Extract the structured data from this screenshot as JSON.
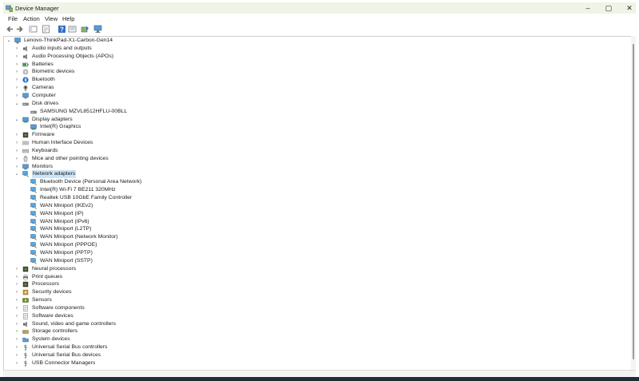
{
  "window": {
    "title": "Device Manager"
  },
  "menu": {
    "file": "File",
    "action": "Action",
    "view": "View",
    "help": "Help"
  },
  "tree": {
    "root": "Lenovo-ThinkPad-X1-Carbon-Gen14",
    "rows": [
      {
        "label": "Audio inputs and outputs",
        "level": 1,
        "state": "collapsed",
        "icon": "speaker-icon"
      },
      {
        "label": "Audio Processing Objects (APOs)",
        "level": 1,
        "state": "collapsed",
        "icon": "speaker-icon"
      },
      {
        "label": "Batteries",
        "level": 1,
        "state": "collapsed",
        "icon": "battery-icon"
      },
      {
        "label": "Biometric devices",
        "level": 1,
        "state": "collapsed",
        "icon": "fingerprint-icon"
      },
      {
        "label": "Bluetooth",
        "level": 1,
        "state": "collapsed",
        "icon": "bluetooth-icon"
      },
      {
        "label": "Cameras",
        "level": 1,
        "state": "collapsed",
        "icon": "camera-icon"
      },
      {
        "label": "Computer",
        "level": 1,
        "state": "collapsed",
        "icon": "monitor-icon"
      },
      {
        "label": "Disk drives",
        "level": 1,
        "state": "expanded",
        "icon": "disk-icon"
      },
      {
        "label": "SAMSUNG MZVL8512HFLU-00BLL",
        "level": 2,
        "state": "leaf",
        "icon": "disk-icon"
      },
      {
        "label": "Display adapters",
        "level": 1,
        "state": "expanded",
        "icon": "display-adapter-icon"
      },
      {
        "label": "Intel(R) Graphics",
        "level": 2,
        "state": "leaf",
        "icon": "display-adapter-icon"
      },
      {
        "label": "Firmware",
        "level": 1,
        "state": "collapsed",
        "icon": "chip-icon"
      },
      {
        "label": "Human Interface Devices",
        "level": 1,
        "state": "collapsed",
        "icon": "hid-icon"
      },
      {
        "label": "Keyboards",
        "level": 1,
        "state": "collapsed",
        "icon": "keyboard-icon"
      },
      {
        "label": "Mice and other pointing devices",
        "level": 1,
        "state": "collapsed",
        "icon": "mouse-icon"
      },
      {
        "label": "Monitors",
        "level": 1,
        "state": "collapsed",
        "icon": "monitor-icon"
      },
      {
        "label": "Network adapters",
        "level": 1,
        "state": "expanded",
        "icon": "network-icon",
        "selected": true
      },
      {
        "label": "Bluetooth Device (Personal Area Network)",
        "level": 2,
        "state": "leaf",
        "icon": "network-icon"
      },
      {
        "label": "Intel(R) Wi-Fi 7 BE211 320MHz",
        "level": 2,
        "state": "leaf",
        "icon": "network-icon"
      },
      {
        "label": "Realtek USB 10GbE Family Controller",
        "level": 2,
        "state": "leaf",
        "icon": "network-icon"
      },
      {
        "label": "WAN Miniport (IKEv2)",
        "level": 2,
        "state": "leaf",
        "icon": "network-icon"
      },
      {
        "label": "WAN Miniport (IP)",
        "level": 2,
        "state": "leaf",
        "icon": "network-icon"
      },
      {
        "label": "WAN Miniport (IPv6)",
        "level": 2,
        "state": "leaf",
        "icon": "network-icon"
      },
      {
        "label": "WAN Miniport (L2TP)",
        "level": 2,
        "state": "leaf",
        "icon": "network-icon"
      },
      {
        "label": "WAN Miniport (Network Monitor)",
        "level": 2,
        "state": "leaf",
        "icon": "network-icon"
      },
      {
        "label": "WAN Miniport (PPPOE)",
        "level": 2,
        "state": "leaf",
        "icon": "network-icon"
      },
      {
        "label": "WAN Miniport (PPTP)",
        "level": 2,
        "state": "leaf",
        "icon": "network-icon"
      },
      {
        "label": "WAN Miniport (SSTP)",
        "level": 2,
        "state": "leaf",
        "icon": "network-icon"
      },
      {
        "label": "Neural processors",
        "level": 1,
        "state": "collapsed",
        "icon": "chip-icon"
      },
      {
        "label": "Print queues",
        "level": 1,
        "state": "collapsed",
        "icon": "printer-icon"
      },
      {
        "label": "Processors",
        "level": 1,
        "state": "collapsed",
        "icon": "chip-icon"
      },
      {
        "label": "Security devices",
        "level": 1,
        "state": "collapsed",
        "icon": "security-icon"
      },
      {
        "label": "Sensors",
        "level": 1,
        "state": "collapsed",
        "icon": "sensor-icon"
      },
      {
        "label": "Software components",
        "level": 1,
        "state": "collapsed",
        "icon": "software-icon"
      },
      {
        "label": "Software devices",
        "level": 1,
        "state": "collapsed",
        "icon": "software-icon"
      },
      {
        "label": "Sound, video and game controllers",
        "level": 1,
        "state": "collapsed",
        "icon": "speaker-icon"
      },
      {
        "label": "Storage controllers",
        "level": 1,
        "state": "collapsed",
        "icon": "storage-icon"
      },
      {
        "label": "System devices",
        "level": 1,
        "state": "collapsed",
        "icon": "folder-icon"
      },
      {
        "label": "Universal Serial Bus controllers",
        "level": 1,
        "state": "collapsed",
        "icon": "usb-icon"
      },
      {
        "label": "Universal Serial Bus devices",
        "level": 1,
        "state": "collapsed",
        "icon": "usb-icon"
      },
      {
        "label": "USB Connector Managers",
        "level": 1,
        "state": "collapsed",
        "icon": "usb-icon"
      }
    ]
  },
  "colors": {
    "titlebar": "#eef4e6",
    "selection": "#cce4f7",
    "taskbar": "#1f2b36"
  }
}
